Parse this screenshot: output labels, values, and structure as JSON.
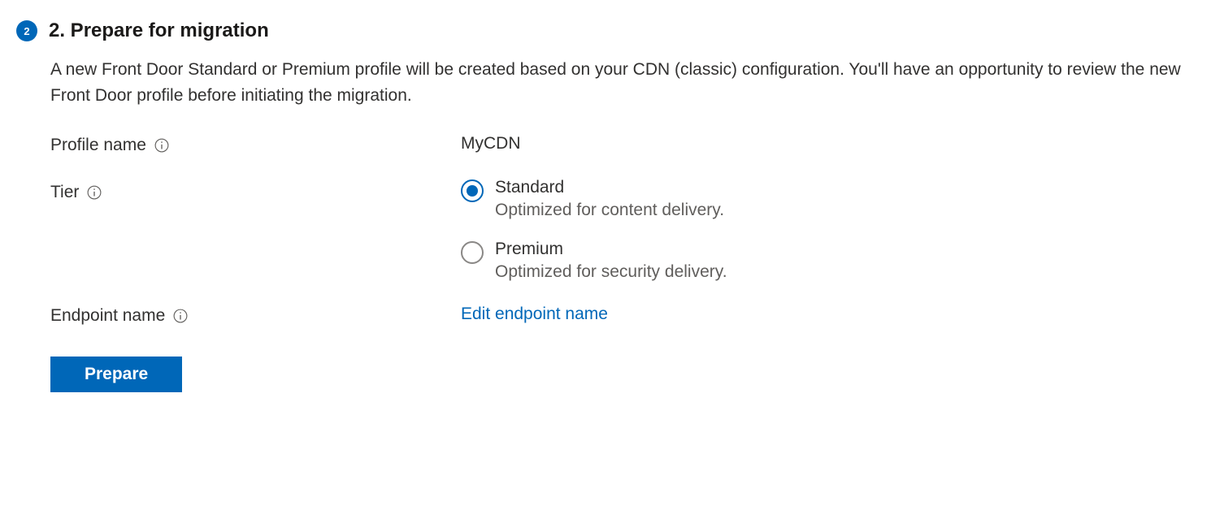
{
  "step": {
    "number": "2",
    "title": "2. Prepare for migration",
    "description": "A new Front Door Standard or Premium profile will be created based on your CDN (classic) configuration. You'll have an opportunity to review the new Front Door profile before initiating the migration."
  },
  "form": {
    "profile_name": {
      "label": "Profile name",
      "value": "MyCDN"
    },
    "tier": {
      "label": "Tier",
      "options": [
        {
          "label": "Standard",
          "description": "Optimized for content delivery.",
          "selected": true
        },
        {
          "label": "Premium",
          "description": "Optimized for security delivery.",
          "selected": false
        }
      ]
    },
    "endpoint_name": {
      "label": "Endpoint name",
      "link_text": "Edit endpoint name"
    }
  },
  "buttons": {
    "prepare": "Prepare"
  }
}
